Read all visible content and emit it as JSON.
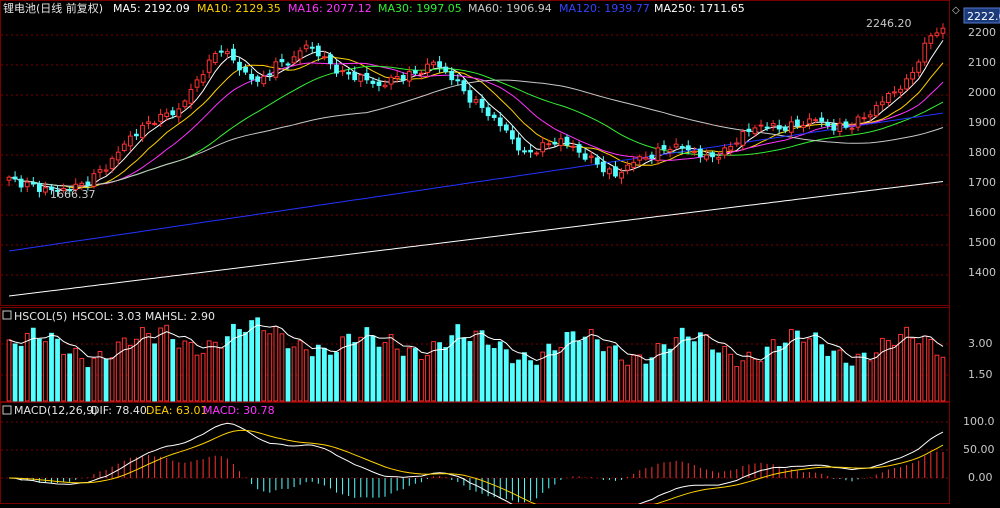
{
  "main_panel": {
    "title": "锂电池(日线 前复权)",
    "legend": [
      {
        "label": "MA5: 2192.09",
        "color": "#ffffff"
      },
      {
        "label": "MA10: 2129.35",
        "color": "#ffd200"
      },
      {
        "label": "MA16: 2077.12",
        "color": "#ff33ff"
      },
      {
        "label": "MA30: 1997.05",
        "color": "#33ee33"
      },
      {
        "label": "MA60: 1906.94",
        "color": "#c8c8c8"
      },
      {
        "label": "MA120: 1939.77",
        "color": "#2233ff"
      },
      {
        "label": "MA250: 1711.65",
        "color": "#ffffff"
      }
    ],
    "current_price_tag": "2222.6",
    "high_label": "2246.20",
    "low_label": "1666.37",
    "y_ticks": [
      "2200",
      "2100",
      "2000",
      "1900",
      "1800",
      "1700",
      "1600",
      "1500",
      "1400"
    ]
  },
  "hscol_panel": {
    "title": "HSCOL(5)",
    "values_label": "HSCOL: 3.03  MAHSL: 2.90",
    "y_ticks": [
      "3.00",
      "1.50"
    ]
  },
  "macd_panel": {
    "title": "MACD(12,26,9)",
    "dif_label": "DIF: 78.40",
    "dea_label": "DEA: 63.01",
    "macd_label": "MACD: 30.78",
    "y_ticks": [
      "100.0",
      "50.00",
      "0.00"
    ]
  },
  "colors": {
    "up": "#ff3232",
    "down": "#54ffff",
    "grid": "#7a0000",
    "axis_text": "#c8c8c8"
  },
  "chart_data": {
    "type": "candlestick",
    "ylim": [
      1320,
      2260
    ],
    "anchors": [
      {
        "i": 0,
        "c": 1720
      },
      {
        "i": 5,
        "c": 1690
      },
      {
        "i": 8,
        "c": 1680
      },
      {
        "i": 12,
        "c": 1700
      },
      {
        "i": 16,
        "c": 1760
      },
      {
        "i": 20,
        "c": 1860
      },
      {
        "i": 24,
        "c": 1920
      },
      {
        "i": 28,
        "c": 1950
      },
      {
        "i": 32,
        "c": 2080
      },
      {
        "i": 35,
        "c": 2160
      },
      {
        "i": 38,
        "c": 2090
      },
      {
        "i": 41,
        "c": 2040
      },
      {
        "i": 44,
        "c": 2100
      },
      {
        "i": 47,
        "c": 2120
      },
      {
        "i": 49,
        "c": 2170
      },
      {
        "i": 52,
        "c": 2120
      },
      {
        "i": 55,
        "c": 2070
      },
      {
        "i": 58,
        "c": 2060
      },
      {
        "i": 61,
        "c": 2030
      },
      {
        "i": 64,
        "c": 2060
      },
      {
        "i": 67,
        "c": 2070
      },
      {
        "i": 70,
        "c": 2110
      },
      {
        "i": 73,
        "c": 2060
      },
      {
        "i": 76,
        "c": 1990
      },
      {
        "i": 79,
        "c": 1940
      },
      {
        "i": 82,
        "c": 1880
      },
      {
        "i": 85,
        "c": 1800
      },
      {
        "i": 88,
        "c": 1830
      },
      {
        "i": 91,
        "c": 1850
      },
      {
        "i": 94,
        "c": 1810
      },
      {
        "i": 97,
        "c": 1770
      },
      {
        "i": 100,
        "c": 1730
      },
      {
        "i": 103,
        "c": 1780
      },
      {
        "i": 106,
        "c": 1800
      },
      {
        "i": 109,
        "c": 1830
      },
      {
        "i": 112,
        "c": 1820
      },
      {
        "i": 115,
        "c": 1790
      },
      {
        "i": 118,
        "c": 1810
      },
      {
        "i": 121,
        "c": 1870
      },
      {
        "i": 124,
        "c": 1900
      },
      {
        "i": 127,
        "c": 1890
      },
      {
        "i": 130,
        "c": 1900
      },
      {
        "i": 133,
        "c": 1920
      },
      {
        "i": 136,
        "c": 1890
      },
      {
        "i": 139,
        "c": 1900
      },
      {
        "i": 142,
        "c": 1940
      },
      {
        "i": 145,
        "c": 2000
      },
      {
        "i": 148,
        "c": 2040
      },
      {
        "i": 150,
        "c": 2120
      },
      {
        "i": 152,
        "c": 2200
      },
      {
        "i": 154,
        "c": 2222.6
      }
    ],
    "ma_final": {
      "MA5": 2192.09,
      "MA10": 2129.35,
      "MA16": 2077.12,
      "MA30": 1997.05,
      "MA60": 1906.94,
      "MA120": 1939.77,
      "MA250": 1711.65
    },
    "hscol_ylim": [
      0,
      4.2
    ],
    "macd_ylim": [
      -35,
      115
    ]
  }
}
